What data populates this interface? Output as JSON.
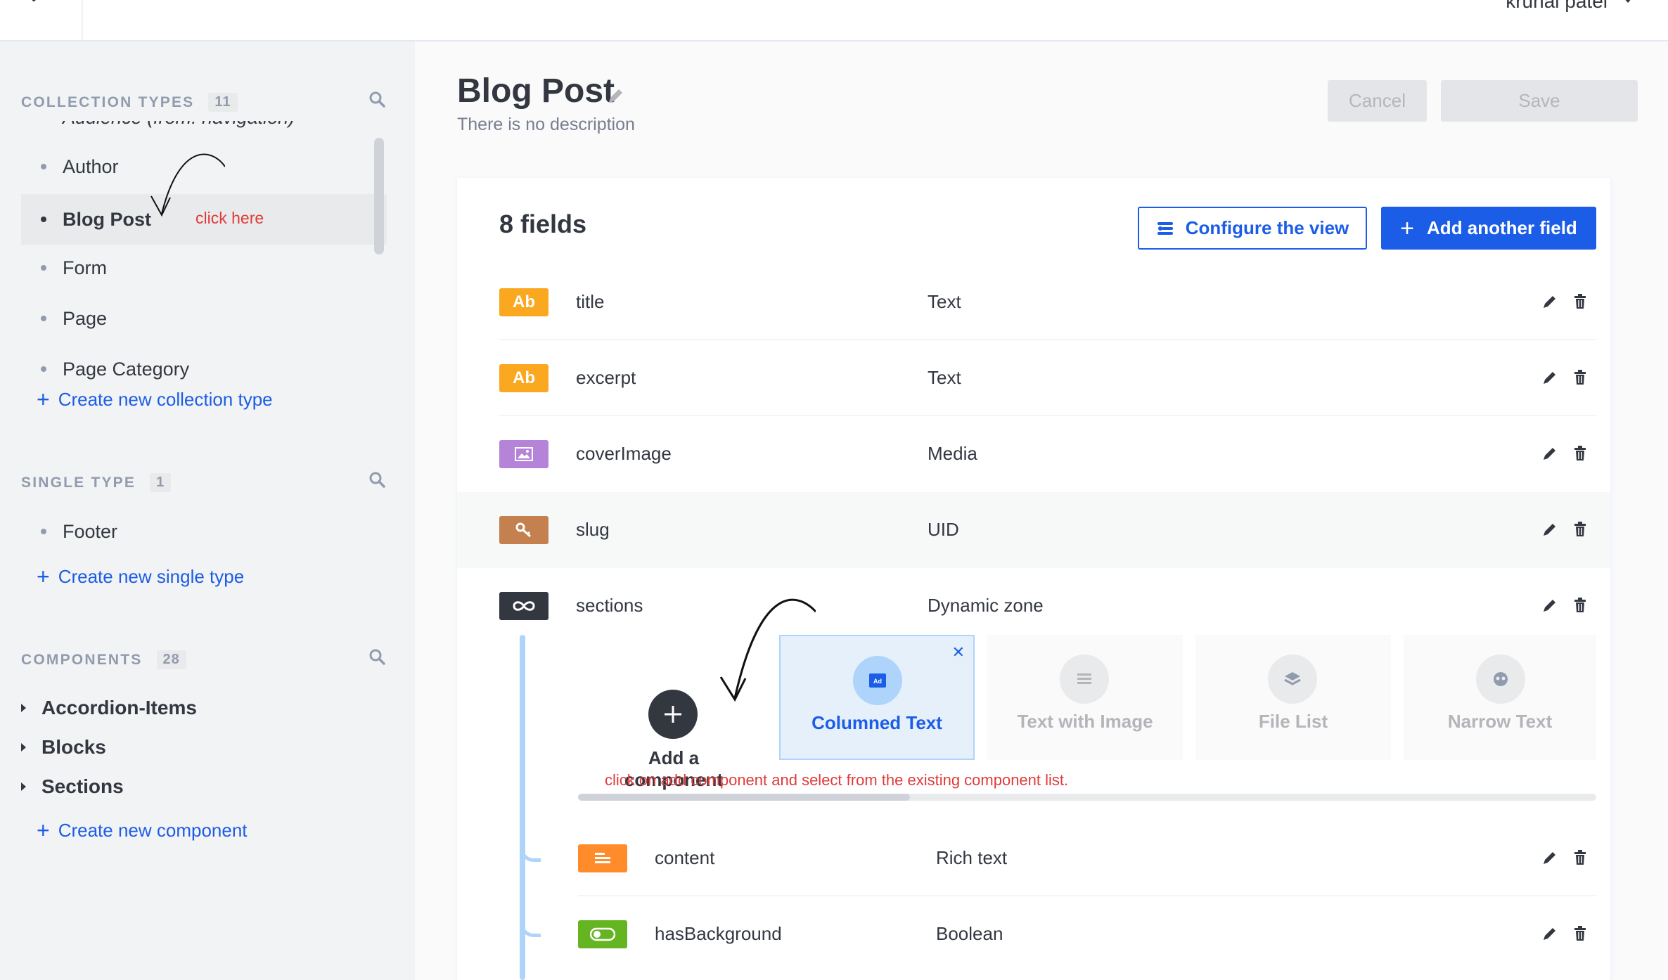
{
  "topbar": {
    "user_name": "krunal patel"
  },
  "sidebar": {
    "collection_types": {
      "title": "Collection Types",
      "count": "11",
      "items": [
        {
          "label": "Audience (from: navigation)"
        },
        {
          "label": "Author"
        },
        {
          "label": "Blog Post"
        },
        {
          "label": "Form"
        },
        {
          "label": "Page"
        },
        {
          "label": "Page Category"
        }
      ],
      "create_label": "Create new collection type"
    },
    "single_type": {
      "title": "Single Type",
      "count": "1",
      "items": [
        {
          "label": "Footer"
        }
      ],
      "create_label": "Create new single type"
    },
    "components": {
      "title": "Components",
      "count": "28",
      "groups": [
        {
          "label": "Accordion-Items"
        },
        {
          "label": "Blocks"
        },
        {
          "label": "Sections"
        }
      ],
      "create_label": "Create new component"
    },
    "annotation": "click here"
  },
  "header": {
    "title": "Blog Post",
    "description": "There is no description",
    "cancel_label": "Cancel",
    "save_label": "Save"
  },
  "main": {
    "fields_count": "8 fields",
    "configure_label": "Configure the view",
    "add_field_label": "Add another field",
    "fields": [
      {
        "name": "title",
        "type": "Text",
        "icon_text": "Ab",
        "icon": "text-icon",
        "color": "#faa820"
      },
      {
        "name": "excerpt",
        "type": "Text",
        "icon_text": "Ab",
        "icon": "text-icon",
        "color": "#faa820"
      },
      {
        "name": "coverImage",
        "type": "Media",
        "icon": "image-icon",
        "color": "#b584d8"
      },
      {
        "name": "slug",
        "type": "UID",
        "icon": "key-icon",
        "color": "#c4804f"
      },
      {
        "name": "sections",
        "type": "Dynamic zone",
        "icon": "infinity-icon",
        "color": "#333740"
      }
    ],
    "dynamic_zone": {
      "add_label": "Add a component",
      "components": [
        {
          "label": "Columned Text",
          "icon": "ad-icon"
        },
        {
          "label": "Text with Image",
          "icon": "list-icon"
        },
        {
          "label": "File List",
          "icon": "layers-icon"
        },
        {
          "label": "Narrow Text",
          "icon": "face-icon"
        }
      ],
      "annotation": "click on add component and select from the existing component list.",
      "sub_fields": [
        {
          "name": "content",
          "type": "Rich text",
          "icon": "richtext-icon",
          "color": "#ff8b2b"
        },
        {
          "name": "hasBackground",
          "type": "Boolean",
          "icon": "toggle-icon",
          "color": "#65b523"
        }
      ]
    }
  }
}
